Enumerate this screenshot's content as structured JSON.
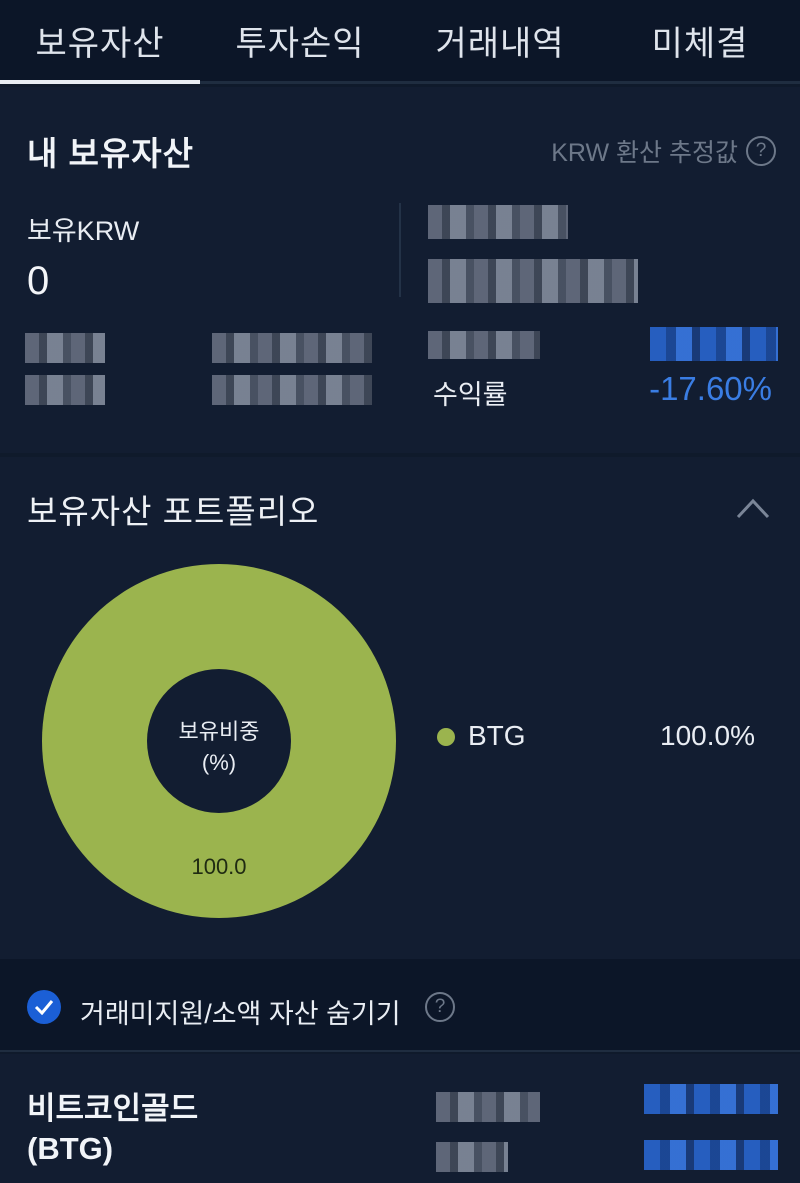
{
  "tabs": [
    {
      "label": "보유자산",
      "active": true
    },
    {
      "label": "투자손익",
      "active": false
    },
    {
      "label": "거래내역",
      "active": false
    },
    {
      "label": "미체결",
      "active": false
    }
  ],
  "summary": {
    "title": "내 보유자산",
    "krw_note": "KRW 환산 추정값",
    "krw_label": "보유KRW",
    "krw_value": "0",
    "rate_label": "수익률",
    "rate_value": "-17.60%"
  },
  "portfolio": {
    "title": "보유자산 포트폴리오",
    "center_label_line1": "보유비중",
    "center_label_line2": "(%)",
    "slice_label": "100.0",
    "legend": [
      {
        "name": "BTG",
        "value": "100.0%",
        "color": "#9bb44e"
      }
    ]
  },
  "chart_data": {
    "type": "pie",
    "categories": [
      "BTG"
    ],
    "values": [
      100.0
    ],
    "title": "",
    "xlabel": "",
    "ylabel": ""
  },
  "options": {
    "hide_small_label": "거래미지원/소액 자산 숨기기",
    "hide_small_checked": true
  },
  "asset": {
    "name_line1": "비트코인골드",
    "name_line2": "(BTG)"
  },
  "colors": {
    "background": "#0f1a2b",
    "accent_blue": "#3a7de3",
    "donut": "#9bb44e"
  }
}
